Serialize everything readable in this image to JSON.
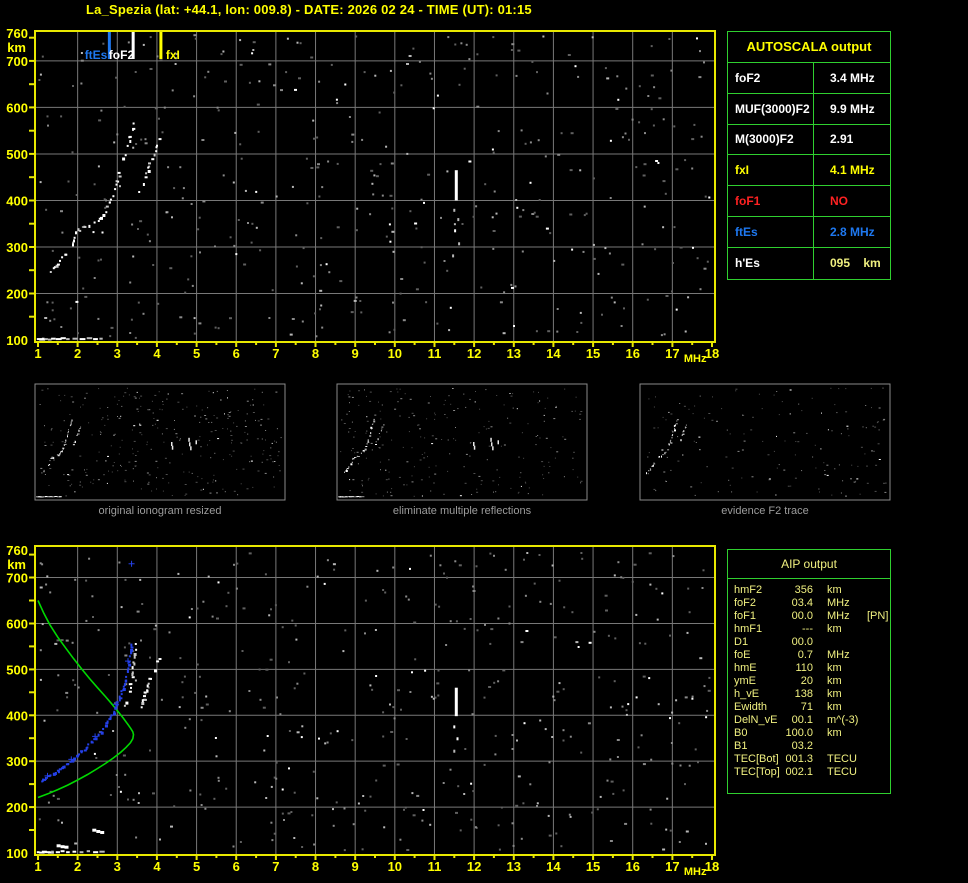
{
  "header": {
    "title": "La_Spezia (lat: +44.1, lon: 009.8) - DATE: 2026 02 24 - TIME (UT): 01:15"
  },
  "colors": {
    "background": "#000000",
    "title_yellow": "#FFFF00",
    "frame_yellow": "#E8E800",
    "grid_gray": "#787878",
    "table_border_green": "#2FCF2F",
    "aip_text": "#F0F080",
    "caption_gray": "#9C9C9C",
    "trace_white": "#FFFFFF",
    "profile_green": "#00D800",
    "restored_blue": "#2440E8",
    "marker_blue": "#1E78F0",
    "alert_red": "#FF2222",
    "thumb_border": "#8A8A8A"
  },
  "autoscala": {
    "title": "AUTOSCALA output",
    "rows": [
      {
        "label": "foF2",
        "value": "3.4 MHz",
        "label_color": "#FFFFFF",
        "value_color": "#FFFFFF"
      },
      {
        "label": "MUF(3000)F2",
        "value": "9.9 MHz",
        "label_color": "#FFFFFF",
        "value_color": "#FFFFFF"
      },
      {
        "label": "M(3000)F2",
        "value": "2.91",
        "label_color": "#FFFFFF",
        "value_color": "#FFFFFF"
      },
      {
        "label": "fxI",
        "value": "4.1 MHz",
        "label_color": "#FFFF00",
        "value_color": "#FFFF00"
      },
      {
        "label": "foF1",
        "value": "NO",
        "label_color": "#FF2222",
        "value_color": "#FF2222"
      },
      {
        "label": "ftEs",
        "value": "2.8 MHz",
        "label_color": "#1E78F0",
        "value_color": "#1E78F0"
      },
      {
        "label": "h'Es",
        "value": "095    km",
        "label_color": "#FFFFFF",
        "value_color": "#F0F080"
      }
    ]
  },
  "aip": {
    "title": "AIP output",
    "rows": [
      {
        "label": "hmF2",
        "value": "356",
        "unit": "km",
        "extra": ""
      },
      {
        "label": "foF2",
        "value": "03.4",
        "unit": "MHz",
        "extra": ""
      },
      {
        "label": "foF1",
        "value": "00.0",
        "unit": "MHz",
        "extra": "[PN]"
      },
      {
        "label": "hmF1",
        "value": "---",
        "unit": "km",
        "extra": ""
      },
      {
        "label": "D1",
        "value": "00.0",
        "unit": "",
        "extra": ""
      },
      {
        "label": "foE",
        "value": "0.7",
        "unit": "MHz",
        "extra": ""
      },
      {
        "label": "hmE",
        "value": "110",
        "unit": "km",
        "extra": ""
      },
      {
        "label": "ymE",
        "value": "20",
        "unit": "km",
        "extra": ""
      },
      {
        "label": "h_vE",
        "value": "138",
        "unit": "km",
        "extra": ""
      },
      {
        "label": "Ewidth",
        "value": "71",
        "unit": "km",
        "extra": ""
      },
      {
        "label": "DelN_vE",
        "value": "00.1",
        "unit": "m^(-3)",
        "extra": ""
      },
      {
        "label": "B0",
        "value": "100.0",
        "unit": "km",
        "extra": ""
      },
      {
        "label": "B1",
        "value": "03.2",
        "unit": "",
        "extra": ""
      },
      {
        "label": "TEC[Bot]",
        "value": "001.3",
        "unit": "TECU",
        "extra": ""
      },
      {
        "label": "TEC[Top]",
        "value": "002.1",
        "unit": "TECU",
        "extra": ""
      }
    ]
  },
  "thumbnails": [
    {
      "caption": "original ionogram resized"
    },
    {
      "caption": "eliminate multiple reflections"
    },
    {
      "caption": "evidence F2 trace"
    }
  ],
  "chart_data": [
    {
      "id": "main_ionogram",
      "type": "scatter",
      "title": "",
      "xlabel": "MHz",
      "ylabel": "km",
      "xlim": [
        1,
        18
      ],
      "ylim": [
        100,
        760
      ],
      "grid": true,
      "x_ticks": [
        1,
        2,
        3,
        4,
        5,
        6,
        7,
        8,
        9,
        10,
        11,
        12,
        13,
        14,
        15,
        16,
        17,
        18
      ],
      "y_ticks": [
        760,
        700,
        600,
        500,
        400,
        300,
        200,
        100
      ],
      "markers": [
        {
          "name": "ftEs",
          "freq_mhz": 2.8,
          "color": "#1E78F0",
          "label_anchor": "end",
          "label_dx": -2
        },
        {
          "name": "foF2",
          "freq_mhz": 3.4,
          "color": "#FFFFFF",
          "label_anchor": "end",
          "label_dx": 1
        },
        {
          "name": "fxI",
          "freq_mhz": 4.1,
          "color": "#FFFF00",
          "label_anchor": "start",
          "label_dx": 5
        }
      ],
      "o_trace": [
        [
          1.3,
          250
        ],
        [
          1.42,
          261
        ],
        [
          1.54,
          272
        ],
        [
          1.66,
          284
        ],
        [
          1.8,
          298
        ],
        [
          1.92,
          332
        ],
        [
          2.02,
          338
        ],
        [
          2.14,
          343
        ],
        [
          2.28,
          348
        ],
        [
          2.42,
          354
        ],
        [
          2.56,
          364
        ],
        [
          2.68,
          379
        ],
        [
          2.79,
          397
        ],
        [
          2.89,
          419
        ],
        [
          2.98,
          443
        ],
        [
          3.06,
          468
        ],
        [
          3.14,
          493
        ],
        [
          3.22,
          517
        ],
        [
          3.3,
          539
        ],
        [
          3.36,
          556
        ],
        [
          3.41,
          568
        ]
      ],
      "x_trace": [
        [
          3.53,
          421
        ],
        [
          3.62,
          440
        ],
        [
          3.71,
          460
        ],
        [
          3.8,
          481
        ],
        [
          3.89,
          501
        ],
        [
          3.97,
          519
        ],
        [
          4.04,
          535
        ]
      ],
      "es_trace": [
        [
          1.02,
          104
        ],
        [
          1.08,
          103
        ],
        [
          1.15,
          105
        ],
        [
          1.22,
          104
        ],
        [
          1.3,
          103
        ],
        [
          1.38,
          105
        ],
        [
          1.5,
          104
        ],
        [
          1.62,
          106
        ],
        [
          1.76,
          104
        ],
        [
          1.92,
          105
        ],
        [
          2.1,
          104
        ],
        [
          2.28,
          106
        ],
        [
          2.44,
          104
        ],
        [
          2.6,
          105
        ]
      ],
      "interference": {
        "freq_mhz": 11.55,
        "km_range": [
          400,
          465
        ]
      },
      "interference_dots": [
        [
          11.5,
          382
        ],
        [
          11.6,
          362
        ],
        [
          11.52,
          338
        ],
        [
          11.62,
          310
        ],
        [
          11.47,
          284
        ]
      ]
    },
    {
      "id": "profile_ionogram",
      "type": "scatter",
      "title": "",
      "xlabel": "MHz",
      "ylabel": "km",
      "xlim": [
        1,
        18
      ],
      "ylim": [
        100,
        760
      ],
      "grid": true,
      "x_ticks": [
        1,
        2,
        3,
        4,
        5,
        6,
        7,
        8,
        9,
        10,
        11,
        12,
        13,
        14,
        15,
        16,
        17,
        18
      ],
      "y_ticks": [
        760,
        700,
        600,
        500,
        400,
        300,
        200,
        100
      ],
      "ne_profile": [
        [
          1.0,
          650
        ],
        [
          1.15,
          622
        ],
        [
          1.3,
          597
        ],
        [
          1.5,
          570
        ],
        [
          1.7,
          546
        ],
        [
          1.9,
          523
        ],
        [
          2.1,
          501
        ],
        [
          2.3,
          480
        ],
        [
          2.5,
          460
        ],
        [
          2.7,
          441
        ],
        [
          2.87,
          424
        ],
        [
          3.02,
          408
        ],
        [
          3.15,
          394
        ],
        [
          3.26,
          381
        ],
        [
          3.34,
          371
        ],
        [
          3.39,
          364
        ],
        [
          3.41,
          358
        ],
        [
          3.39,
          349
        ],
        [
          3.33,
          340
        ],
        [
          3.22,
          330
        ],
        [
          3.08,
          319
        ],
        [
          2.9,
          307
        ],
        [
          2.7,
          295
        ],
        [
          2.48,
          283
        ],
        [
          2.25,
          271
        ],
        [
          2.0,
          259
        ],
        [
          1.75,
          248
        ],
        [
          1.5,
          238
        ],
        [
          1.25,
          229
        ],
        [
          1.0,
          221
        ]
      ],
      "restored_trace": [
        [
          1.02,
          257
        ],
        [
          1.12,
          262
        ],
        [
          1.24,
          268
        ],
        [
          1.36,
          274
        ],
        [
          1.48,
          281
        ],
        [
          1.6,
          288
        ],
        [
          1.72,
          296
        ],
        [
          1.84,
          304
        ],
        [
          1.96,
          313
        ],
        [
          2.08,
          322
        ],
        [
          2.2,
          332
        ],
        [
          2.32,
          343
        ],
        [
          2.44,
          354
        ],
        [
          2.56,
          366
        ],
        [
          2.67,
          379
        ],
        [
          2.78,
          393
        ],
        [
          2.88,
          408
        ],
        [
          2.97,
          424
        ],
        [
          3.05,
          441
        ],
        [
          3.12,
          459
        ],
        [
          3.18,
          478
        ],
        [
          3.23,
          498
        ],
        [
          3.27,
          518
        ],
        [
          3.3,
          538
        ],
        [
          3.32,
          556
        ]
      ],
      "isolated_points": [
        [
          3.36,
          730
        ]
      ],
      "o_trace": [
        [
          3.18,
          425
        ],
        [
          3.25,
          447
        ],
        [
          3.31,
          470
        ],
        [
          3.36,
          494
        ],
        [
          3.4,
          517
        ],
        [
          3.43,
          538
        ],
        [
          3.45,
          556
        ]
      ],
      "x_trace": [
        [
          3.55,
          415
        ],
        [
          3.63,
          436
        ],
        [
          3.72,
          458
        ],
        [
          3.81,
          480
        ],
        [
          3.9,
          500
        ],
        [
          3.98,
          518
        ],
        [
          4.05,
          534
        ]
      ],
      "es_trace": [
        [
          1.02,
          104
        ],
        [
          1.08,
          103
        ],
        [
          1.15,
          105
        ],
        [
          1.22,
          104
        ],
        [
          1.3,
          103
        ],
        [
          1.38,
          105
        ],
        [
          1.5,
          104
        ],
        [
          1.62,
          106
        ],
        [
          1.76,
          104
        ],
        [
          1.92,
          105
        ],
        [
          2.1,
          104
        ],
        [
          2.28,
          106
        ],
        [
          2.44,
          104
        ],
        [
          2.6,
          105
        ]
      ],
      "blobs": [
        [
          1.52,
          119
        ],
        [
          1.62,
          117
        ],
        [
          1.72,
          116
        ],
        [
          2.42,
          153
        ],
        [
          2.52,
          150
        ],
        [
          2.62,
          148
        ]
      ],
      "interference": {
        "freq_mhz": 11.55,
        "km_range": [
          398,
          460
        ]
      },
      "interference_dots": [
        [
          11.5,
          378
        ],
        [
          11.58,
          352
        ],
        [
          11.5,
          325
        ]
      ]
    }
  ],
  "thumb_fragments": [
    [
      10.3,
      430
    ],
    [
      10.35,
      408
    ],
    [
      11.5,
      455
    ],
    [
      11.55,
      428
    ],
    [
      11.62,
      404
    ],
    [
      12.0,
      440
    ]
  ]
}
